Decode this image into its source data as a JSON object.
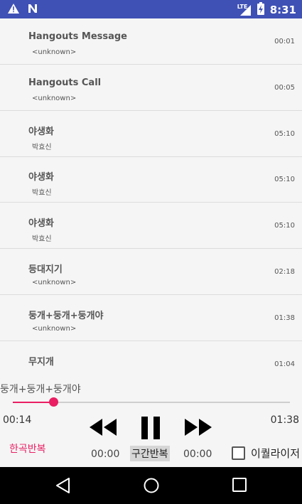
{
  "status_bar": {
    "time": "8:31",
    "network": "LTE",
    "icons": [
      "warning-icon",
      "n-notification-icon",
      "lte-signal-icon",
      "battery-charging-icon"
    ]
  },
  "tracks": [
    {
      "title": "Hangouts Message",
      "artist": "<unknown>",
      "duration": "00:01"
    },
    {
      "title": "Hangouts Call",
      "artist": "<unknown>",
      "duration": "00:05"
    },
    {
      "title": "야생화",
      "artist": "박효신",
      "duration": "05:10"
    },
    {
      "title": "야생화",
      "artist": "박효신",
      "duration": "05:10"
    },
    {
      "title": "야생화",
      "artist": "박효신",
      "duration": "05:10"
    },
    {
      "title": "등대지기",
      "artist": "<unknown>",
      "duration": "02:18"
    },
    {
      "title": "둥개+둥개+둥개야",
      "artist": "<unknown>",
      "duration": "01:38"
    },
    {
      "title": "무지개",
      "artist": "",
      "duration": "01:04"
    }
  ],
  "player": {
    "now_playing": "둥개+둥개+둥개야",
    "elapsed": "00:14",
    "total": "01:38",
    "progress_fraction": 0.145,
    "accent_color": "#e91e63",
    "controls": [
      "rewind-icon",
      "pause-icon",
      "fast-forward-icon"
    ],
    "repeat_one_label": "한곡반복",
    "a_time": "00:00",
    "section_repeat_label": "구간반복",
    "b_time": "00:00",
    "equalizer_label": "이퀄라이저",
    "equalizer_checked": false
  },
  "nav_bar": {
    "buttons": [
      "back-icon",
      "home-icon",
      "recents-icon"
    ]
  }
}
